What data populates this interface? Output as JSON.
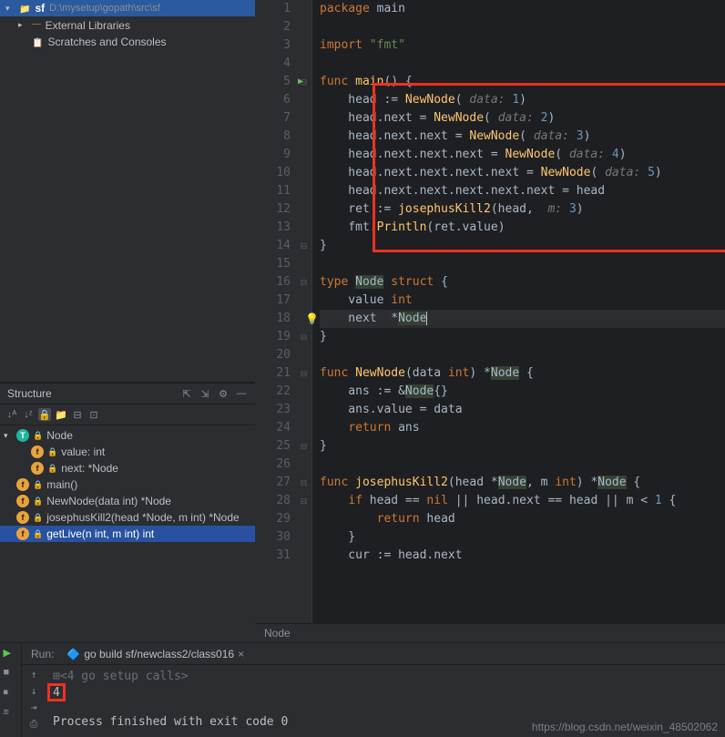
{
  "project": {
    "root_name": "sf",
    "root_path": "D:\\mysetup\\gopath\\src\\sf",
    "items": [
      {
        "label": "External Libraries",
        "icon": "lib"
      },
      {
        "label": "Scratches and Consoles",
        "icon": "scratch"
      }
    ]
  },
  "structure": {
    "title": "Structure",
    "root": "Node",
    "fields": [
      "value: int",
      "next: *Node"
    ],
    "funcs": [
      "main()",
      "NewNode(data int) *Node",
      "josephusKill2(head *Node, m int) *Node",
      "getLive(n int, m int) int"
    ]
  },
  "code": {
    "lines": [
      {
        "n": 1,
        "tokens": [
          {
            "t": "package ",
            "c": "kw"
          },
          {
            "t": "main",
            "c": "pkg"
          }
        ]
      },
      {
        "n": 2,
        "tokens": []
      },
      {
        "n": 3,
        "tokens": [
          {
            "t": "import ",
            "c": "kw"
          },
          {
            "t": "\"fmt\"",
            "c": "str"
          }
        ]
      },
      {
        "n": 4,
        "tokens": []
      },
      {
        "n": 5,
        "run": true,
        "fold": "⊟",
        "tokens": [
          {
            "t": "func ",
            "c": "kw"
          },
          {
            "t": "main",
            "c": "fn"
          },
          {
            "t": "() {",
            "c": "ident"
          }
        ]
      },
      {
        "n": 6,
        "tokens": [
          {
            "t": "    head := ",
            "c": "ident"
          },
          {
            "t": "NewNode",
            "c": "fn"
          },
          {
            "t": "( ",
            "c": "ident"
          },
          {
            "t": "data: ",
            "c": "hint"
          },
          {
            "t": "1",
            "c": "num"
          },
          {
            "t": ")",
            "c": "ident"
          }
        ]
      },
      {
        "n": 7,
        "tokens": [
          {
            "t": "    head.next = ",
            "c": "ident"
          },
          {
            "t": "NewNode",
            "c": "fn"
          },
          {
            "t": "( ",
            "c": "ident"
          },
          {
            "t": "data: ",
            "c": "hint"
          },
          {
            "t": "2",
            "c": "num"
          },
          {
            "t": ")",
            "c": "ident"
          }
        ]
      },
      {
        "n": 8,
        "tokens": [
          {
            "t": "    head.next.next = ",
            "c": "ident"
          },
          {
            "t": "NewNode",
            "c": "fn"
          },
          {
            "t": "( ",
            "c": "ident"
          },
          {
            "t": "data: ",
            "c": "hint"
          },
          {
            "t": "3",
            "c": "num"
          },
          {
            "t": ")",
            "c": "ident"
          }
        ]
      },
      {
        "n": 9,
        "tokens": [
          {
            "t": "    head.next.next.next = ",
            "c": "ident"
          },
          {
            "t": "NewNode",
            "c": "fn"
          },
          {
            "t": "( ",
            "c": "ident"
          },
          {
            "t": "data: ",
            "c": "hint"
          },
          {
            "t": "4",
            "c": "num"
          },
          {
            "t": ")",
            "c": "ident"
          }
        ]
      },
      {
        "n": 10,
        "tokens": [
          {
            "t": "    head.next.next.next.next = ",
            "c": "ident"
          },
          {
            "t": "NewNode",
            "c": "fn"
          },
          {
            "t": "( ",
            "c": "ident"
          },
          {
            "t": "data: ",
            "c": "hint"
          },
          {
            "t": "5",
            "c": "num"
          },
          {
            "t": ")",
            "c": "ident"
          }
        ]
      },
      {
        "n": 11,
        "tokens": [
          {
            "t": "    head.next.next.next.next.next = head",
            "c": "ident"
          }
        ]
      },
      {
        "n": 12,
        "tokens": [
          {
            "t": "    ret := ",
            "c": "ident"
          },
          {
            "t": "josephusKill2",
            "c": "fn"
          },
          {
            "t": "(head,  ",
            "c": "ident"
          },
          {
            "t": "m: ",
            "c": "hint"
          },
          {
            "t": "3",
            "c": "num"
          },
          {
            "t": ")",
            "c": "ident"
          }
        ]
      },
      {
        "n": 13,
        "tokens": [
          {
            "t": "    fmt.",
            "c": "ident"
          },
          {
            "t": "Println",
            "c": "fn"
          },
          {
            "t": "(ret.value)",
            "c": "ident"
          }
        ]
      },
      {
        "n": 14,
        "fold": "⊟",
        "tokens": [
          {
            "t": "}",
            "c": "ident"
          }
        ]
      },
      {
        "n": 15,
        "tokens": []
      },
      {
        "n": 16,
        "fold": "⊟",
        "tokens": [
          {
            "t": "type ",
            "c": "kw"
          },
          {
            "t": "Node",
            "c": "typeref"
          },
          {
            "t": " ",
            "c": ""
          },
          {
            "t": "struct",
            "c": "kw"
          },
          {
            "t": " {",
            "c": "ident"
          }
        ]
      },
      {
        "n": 17,
        "tokens": [
          {
            "t": "    value ",
            "c": "ident"
          },
          {
            "t": "int",
            "c": "kw"
          }
        ]
      },
      {
        "n": 18,
        "hl": true,
        "bulb": true,
        "tokens": [
          {
            "t": "    next  *",
            "c": "ident"
          },
          {
            "t": "Node",
            "c": "typeref"
          }
        ],
        "cursor": true
      },
      {
        "n": 19,
        "fold": "⊟",
        "tokens": [
          {
            "t": "}",
            "c": "ident"
          }
        ]
      },
      {
        "n": 20,
        "tokens": []
      },
      {
        "n": 21,
        "fold": "⊟",
        "tokens": [
          {
            "t": "func ",
            "c": "kw"
          },
          {
            "t": "NewNode",
            "c": "fn"
          },
          {
            "t": "(data ",
            "c": "ident"
          },
          {
            "t": "int",
            "c": "kw"
          },
          {
            "t": ") *",
            "c": "ident"
          },
          {
            "t": "Node",
            "c": "typeref"
          },
          {
            "t": " {",
            "c": "ident"
          }
        ]
      },
      {
        "n": 22,
        "tokens": [
          {
            "t": "    ans := &",
            "c": "ident"
          },
          {
            "t": "Node",
            "c": "typeref"
          },
          {
            "t": "{}",
            "c": "ident"
          }
        ]
      },
      {
        "n": 23,
        "tokens": [
          {
            "t": "    ans.value = data",
            "c": "ident"
          }
        ]
      },
      {
        "n": 24,
        "tokens": [
          {
            "t": "    ",
            "c": ""
          },
          {
            "t": "return ",
            "c": "kw"
          },
          {
            "t": "ans",
            "c": "ident"
          }
        ]
      },
      {
        "n": 25,
        "fold": "⊟",
        "tokens": [
          {
            "t": "}",
            "c": "ident"
          }
        ]
      },
      {
        "n": 26,
        "tokens": []
      },
      {
        "n": 27,
        "fold": "⊟",
        "tokens": [
          {
            "t": "func ",
            "c": "kw"
          },
          {
            "t": "josephusKill2",
            "c": "fn"
          },
          {
            "t": "(head *",
            "c": "ident"
          },
          {
            "t": "Node",
            "c": "typeref"
          },
          {
            "t": ", m ",
            "c": "ident"
          },
          {
            "t": "int",
            "c": "kw"
          },
          {
            "t": ") *",
            "c": "ident"
          },
          {
            "t": "Node",
            "c": "typeref"
          },
          {
            "t": " {",
            "c": "ident"
          }
        ]
      },
      {
        "n": 28,
        "fold": "⊟",
        "tokens": [
          {
            "t": "    ",
            "c": ""
          },
          {
            "t": "if ",
            "c": "kw"
          },
          {
            "t": "head == ",
            "c": "ident"
          },
          {
            "t": "nil ",
            "c": "kw"
          },
          {
            "t": "|| head.next == head || m < ",
            "c": "ident"
          },
          {
            "t": "1 ",
            "c": "num"
          },
          {
            "t": "{",
            "c": "ident"
          }
        ]
      },
      {
        "n": 29,
        "tokens": [
          {
            "t": "        ",
            "c": ""
          },
          {
            "t": "return ",
            "c": "kw"
          },
          {
            "t": "head",
            "c": "ident"
          }
        ]
      },
      {
        "n": 30,
        "tokens": [
          {
            "t": "    }",
            "c": "ident"
          }
        ]
      },
      {
        "n": 31,
        "tokens": [
          {
            "t": "    cur := head.next",
            "c": "ident"
          }
        ]
      }
    ]
  },
  "breadcrumb": "Node",
  "run": {
    "label": "Run:",
    "tab": "go build sf/newclass2/class016",
    "setup": "<4 go setup calls>",
    "output_val": "4",
    "finished": "Process finished with exit code 0"
  },
  "watermark": "https://blog.csdn.net/weixin_48502062"
}
